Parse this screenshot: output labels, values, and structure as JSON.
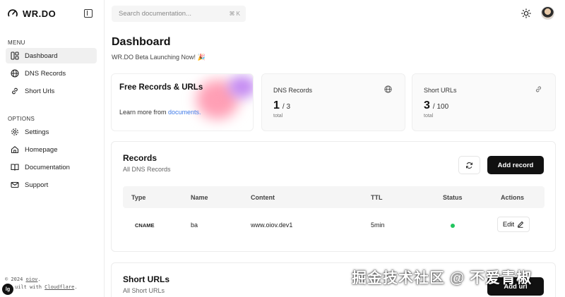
{
  "brand": {
    "name": "WR.DO"
  },
  "sidebar": {
    "menu_label": "MENU",
    "options_label": "OPTIONS",
    "menu_items": [
      {
        "label": "Dashboard",
        "icon": "dashboard-icon",
        "active": true
      },
      {
        "label": "DNS Records",
        "icon": "globe-icon"
      },
      {
        "label": "Short Urls",
        "icon": "link-icon"
      }
    ],
    "option_items": [
      {
        "label": "Settings",
        "icon": "gear-icon"
      },
      {
        "label": "Homepage",
        "icon": "home-icon"
      },
      {
        "label": "Documentation",
        "icon": "book-icon"
      },
      {
        "label": "Support",
        "icon": "mail-icon"
      }
    ],
    "footer_line1_prefix": "© 2024 ",
    "footer_line1_link": "oiov",
    "footer_line1_suffix": ".",
    "footer_line2_prefix": "uilt with ",
    "footer_line2_link": "Cloudflare",
    "footer_line2_suffix": ".",
    "badge": "lg"
  },
  "header": {
    "search_placeholder": "Search documentation...",
    "search_shortcut": "⌘ K"
  },
  "page": {
    "title": "Dashboard",
    "subtitle": "WR.DO Beta Launching Now! 🎉"
  },
  "cards": {
    "promo": {
      "title": "Free Records & URLs",
      "learn_prefix": "Learn more from ",
      "learn_link": "documents."
    },
    "dns": {
      "label": "DNS Records",
      "value": "1",
      "total": "/ 3",
      "sub": "total"
    },
    "short": {
      "label": "Short URLs",
      "value": "3",
      "total": "/ 100",
      "sub": "total"
    }
  },
  "records": {
    "title": "Records",
    "subtitle": "All DNS Records",
    "add_label": "Add record",
    "columns": [
      "Type",
      "Name",
      "Content",
      "TTL",
      "Status",
      "Actions"
    ],
    "rows": [
      {
        "type": "CNAME",
        "name": "ba",
        "content": "www.oiov.dev1",
        "ttl": "5min",
        "status": "active",
        "action": "Edit"
      }
    ]
  },
  "short_urls": {
    "title": "Short URLs",
    "subtitle": "All Short URLs",
    "add_label": "Add url"
  },
  "watermark": "掘金技术社区 @ 不爱青椒",
  "colors": {
    "accent_link": "#3f7be8",
    "status_active": "#22c55e",
    "primary_button": "#111111"
  }
}
